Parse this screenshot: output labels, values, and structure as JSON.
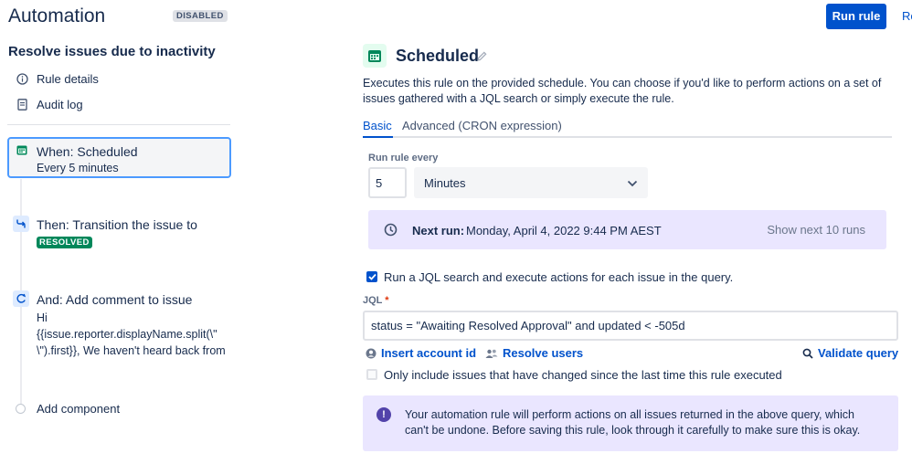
{
  "header": {
    "title": "Automation",
    "status_badge": "DISABLED",
    "run_rule_label": "Run rule",
    "next_action_label": "Re"
  },
  "sidebar": {
    "rule_name": "Resolve issues due to inactivity",
    "nav": [
      {
        "label": "Rule details",
        "icon": "info-icon"
      },
      {
        "label": "Audit log",
        "icon": "document-icon"
      }
    ],
    "components": [
      {
        "title": "When: Scheduled",
        "subtitle": "Every 5 minutes",
        "icon": "calendar-icon",
        "selected": true
      },
      {
        "title": "Then: Transition the issue to",
        "badge": "RESOLVED",
        "icon": "transition-icon"
      },
      {
        "title": "And: Add comment to issue",
        "lines": [
          "Hi",
          "{{issue.reporter.displayName.split(\\\"",
          "\\\").first}}, We haven't heard back from"
        ],
        "icon": "comment-icon"
      }
    ],
    "add_component_label": "Add component"
  },
  "main": {
    "title": "Scheduled",
    "description": "Executes this rule on the provided schedule. You can choose if you'd like to perform actions on a set of issues gathered with a JQL search or simply execute the rule.",
    "tabs": [
      {
        "label": "Basic",
        "active": true
      },
      {
        "label": "Advanced (CRON expression)",
        "active": false
      }
    ],
    "run_every_label": "Run rule every",
    "interval_value": "5",
    "interval_unit": "Minutes",
    "next_run": {
      "label": "Next run:",
      "value": "Monday, April 4, 2022 9:44 PM AEST",
      "show_more_label": "Show next 10 runs"
    },
    "jql_checkbox": {
      "label": "Run a JQL search and execute actions for each issue in the query.",
      "checked": true
    },
    "jql_label": "JQL",
    "jql_required_marker": "*",
    "jql_value": "status = \"Awaiting Resolved Approval\" and updated < -505d",
    "insert_account_label": "Insert account id",
    "resolve_users_label": "Resolve users",
    "validate_label": "Validate query",
    "changed_checkbox": {
      "label": "Only include issues that have changed since the last time this rule executed",
      "checked": false
    },
    "warning_text": "Your automation rule will perform actions on all issues returned in the above query, which can't be undone. Before saving this rule, look through it carefully to make sure this is okay."
  },
  "colors": {
    "primary": "#0052CC",
    "selected_border": "#4C9AFF",
    "success": "#00875A",
    "info_bg": "#EAE6FF",
    "warning_icon": "#5243AA"
  }
}
